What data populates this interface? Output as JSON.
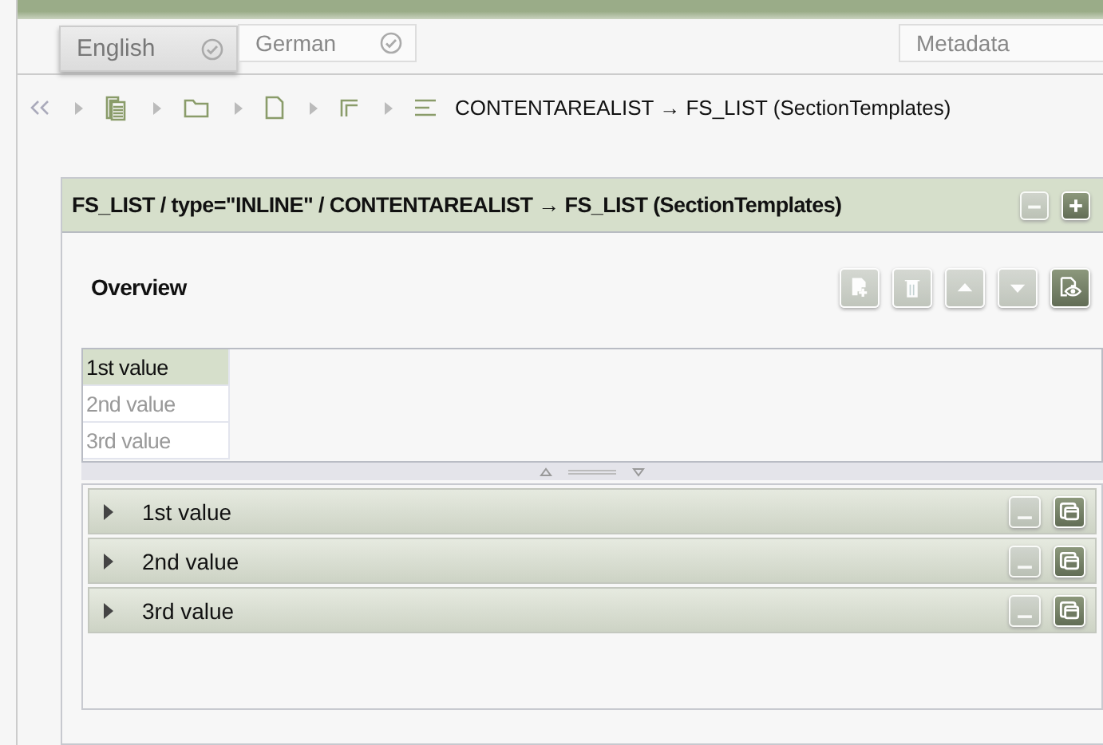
{
  "tabs": [
    {
      "label": "English",
      "selected": true,
      "kind": "language"
    },
    {
      "label": "German",
      "selected": false,
      "kind": "language"
    },
    {
      "label": "Metadata",
      "selected": false,
      "kind": "plain"
    }
  ],
  "breadcrumb": {
    "items": [
      {
        "kind": "pages"
      },
      {
        "kind": "folder"
      },
      {
        "kind": "page"
      },
      {
        "kind": "section"
      },
      {
        "kind": "list"
      }
    ],
    "text": "CONTENTAREALIST → FS_LIST (SectionTemplates)"
  },
  "panel": {
    "title": "FS_LIST / type=\"INLINE\" / CONTENTAREALIST → FS_LIST (SectionTemplates)",
    "header_buttons": [
      {
        "kind": "collapse",
        "disabled": true
      },
      {
        "kind": "expand",
        "disabled": false
      }
    ],
    "overview": {
      "title": "Overview",
      "toolbar": [
        {
          "kind": "add",
          "disabled": true
        },
        {
          "kind": "delete",
          "disabled": true
        },
        {
          "kind": "up",
          "disabled": true
        },
        {
          "kind": "down",
          "disabled": true
        },
        {
          "kind": "preview",
          "disabled": false
        }
      ],
      "items": [
        {
          "label": "1st value",
          "selected": true
        },
        {
          "label": "2nd value",
          "selected": false
        },
        {
          "label": "3rd value",
          "selected": false
        }
      ]
    },
    "sections": [
      {
        "label": "1st value",
        "expanded": false,
        "buttons": [
          {
            "kind": "minimize",
            "disabled": true
          },
          {
            "kind": "window",
            "disabled": false
          }
        ]
      },
      {
        "label": "2nd value",
        "expanded": false,
        "buttons": [
          {
            "kind": "minimize",
            "disabled": true
          },
          {
            "kind": "window",
            "disabled": false
          }
        ]
      },
      {
        "label": "3rd value",
        "expanded": false,
        "buttons": [
          {
            "kind": "minimize",
            "disabled": true
          },
          {
            "kind": "window",
            "disabled": false
          }
        ]
      }
    ]
  }
}
